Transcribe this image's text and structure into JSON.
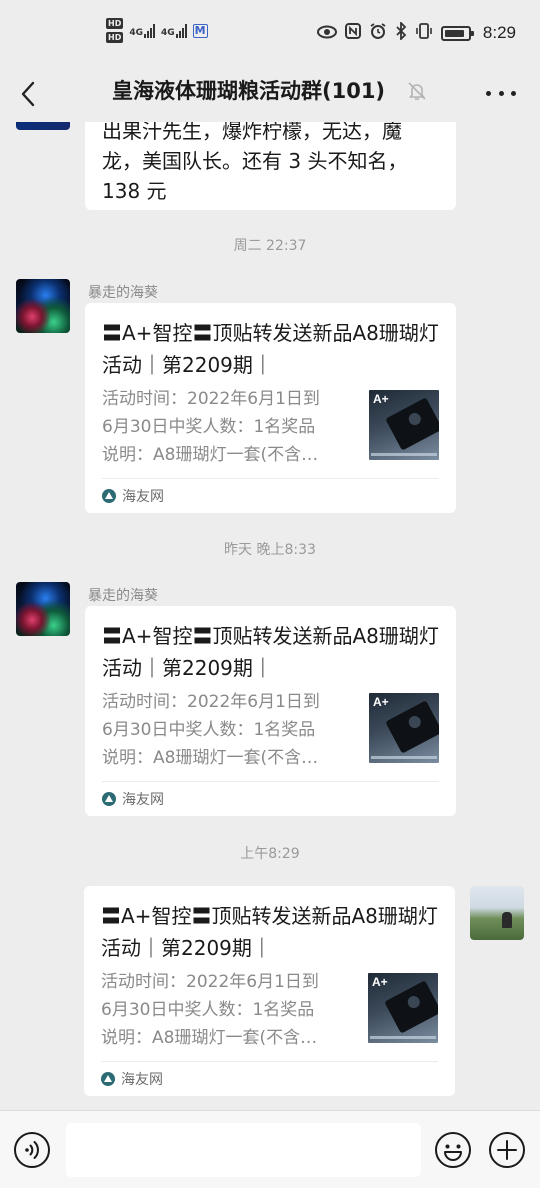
{
  "status_bar": {
    "hd1": "HD",
    "hd2": "HD",
    "net1": "4G",
    "net2": "4G",
    "m_badge": "M",
    "time": "8:29",
    "battery_level": 0.85
  },
  "header": {
    "title": "皇海液体珊瑚粮活动群(101)"
  },
  "chat": {
    "prev_message": {
      "line1": "出果汁先生，爆炸柠檬，无达，魔",
      "line2": "龙，美国队长。还有 3 头不知名，",
      "line3": "138 元"
    },
    "messages": [
      {
        "timestamp": "周二 22:37",
        "sender": "暴走的海葵",
        "card": {
          "title": "〓A+智控〓顶贴转发送新品A8珊瑚灯活动｜第2209期｜",
          "desc_line1": "活动时间：2022年6月1日到",
          "desc_line2": "6月30日中奖人数：1名奖品",
          "desc_line3": "说明：A8珊瑚灯一套(不含…",
          "thumb_label": "A+",
          "source": "海友网"
        }
      },
      {
        "timestamp": "昨天 晚上8:33",
        "sender": "暴走的海葵",
        "card": {
          "title": "〓A+智控〓顶贴转发送新品A8珊瑚灯活动｜第2209期｜",
          "desc_line1": "活动时间：2022年6月1日到",
          "desc_line2": "6月30日中奖人数：1名奖品",
          "desc_line3": "说明：A8珊瑚灯一套(不含…",
          "thumb_label": "A+",
          "source": "海友网"
        }
      },
      {
        "timestamp": "上午8:29",
        "sender": "",
        "card": {
          "title": "〓A+智控〓顶贴转发送新品A8珊瑚灯活动｜第2209期｜",
          "desc_line1": "活动时间：2022年6月1日到",
          "desc_line2": "6月30日中奖人数：1名奖品",
          "desc_line3": "说明：A8珊瑚灯一套(不含…",
          "thumb_label": "A+",
          "source": "海友网"
        }
      }
    ]
  },
  "input": {
    "placeholder": ""
  }
}
